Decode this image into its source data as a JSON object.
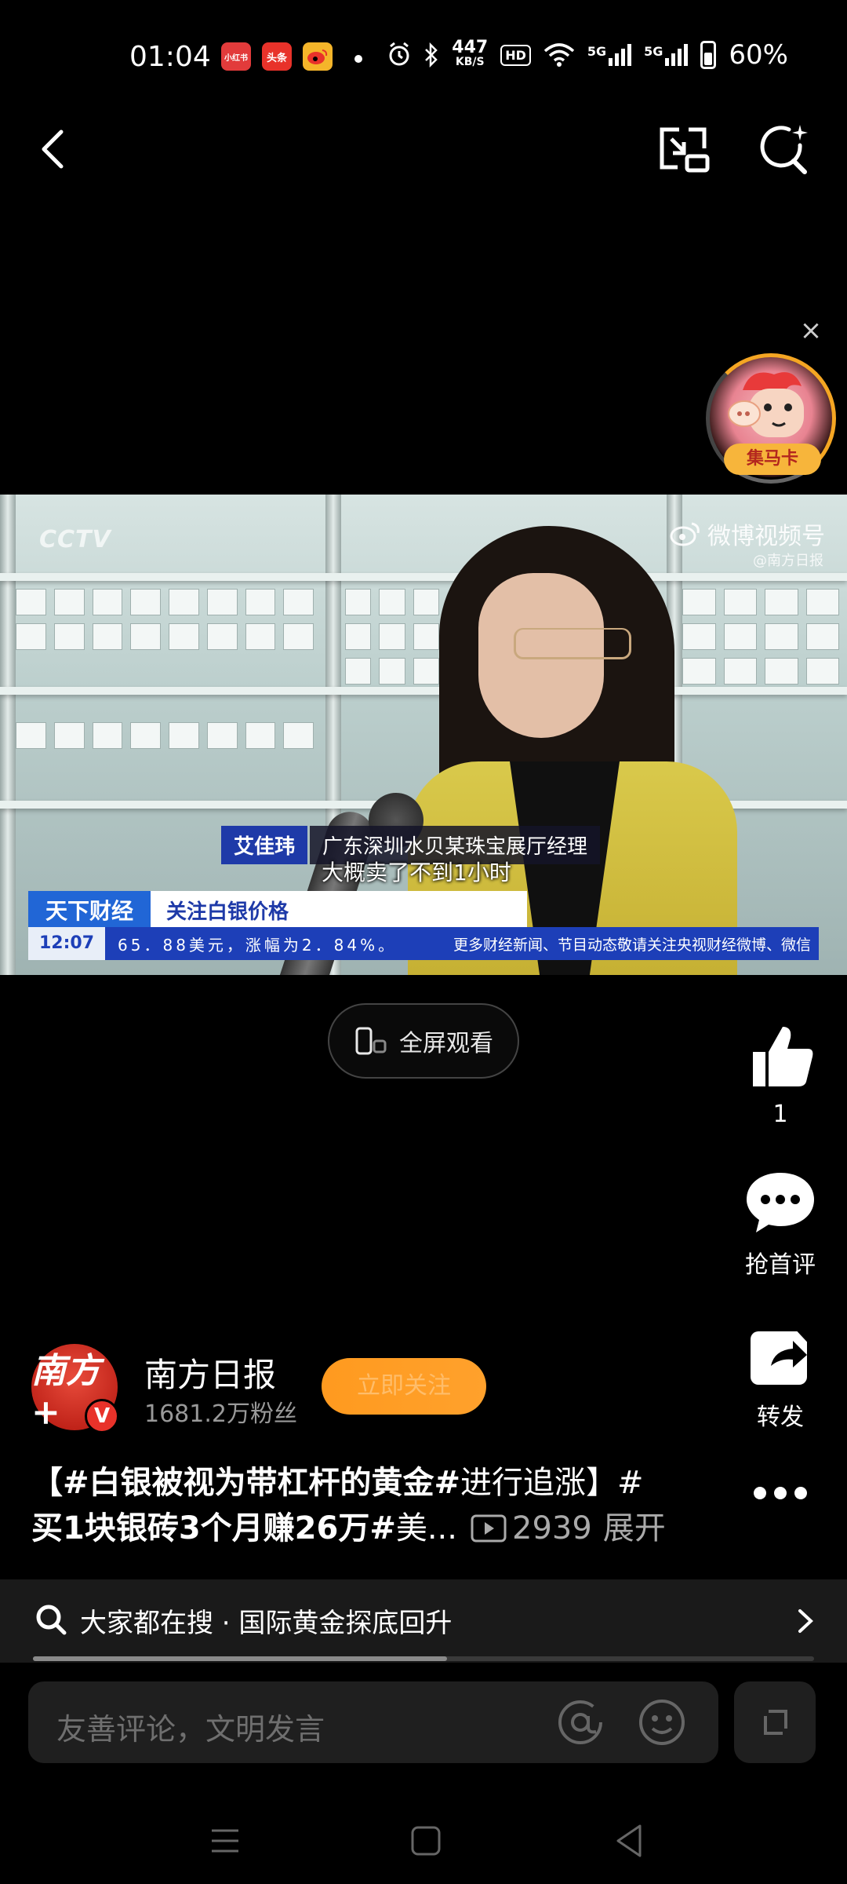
{
  "status_bar": {
    "time": "01:04",
    "app_icons": [
      {
        "label": "小红书",
        "color": "#e23b3b"
      },
      {
        "label": "头条",
        "color": "#e8322a"
      },
      {
        "label": "微博",
        "color": "#f5b52a"
      }
    ],
    "net_speed_value": "447",
    "net_speed_unit": "KB/S",
    "hd": "HD",
    "signal_1": "5G",
    "signal_2": "5G",
    "battery": "60%"
  },
  "nav": {
    "back": "back-arrow-icon",
    "pip": "picture-in-picture-icon",
    "smart_search": "sparkle-search-icon"
  },
  "float_card": {
    "close": "×",
    "label": "集马卡"
  },
  "video": {
    "channel_logo": "CCTV",
    "watermark": "微博视频号",
    "watermark_sub": "@南方日报",
    "speaker_name": "艾佳玮",
    "speaker_title": "广东深圳水贝某珠宝展厅经理",
    "subtitle": "大概卖了不到1小时",
    "program": "天下财经",
    "topic": "关注白银价格",
    "ticker_time": "12:07",
    "ticker_text": "65．88美元，涨幅为2．84%。",
    "ticker_text2": "更多财经新闻、节目动态敬请关注央视财经微博、微信"
  },
  "fullscreen_button": "全屏观看",
  "actions": {
    "like_count": "1",
    "comment_label": "抢首评",
    "share_label": "转发"
  },
  "author": {
    "avatar_text": "南方+",
    "verified": "V",
    "name": "南方日报",
    "fans": "1681.2万粉丝",
    "follow_label": "立即关注"
  },
  "caption": {
    "line1_bold": "【#白银被视为带杠杆的黄金#",
    "line1_normal": "进行追涨】#",
    "line2_bold": "买1块银砖3个月赚26万#",
    "line2_normal": " 美...",
    "views": "2939",
    "expand": "展开"
  },
  "search": {
    "text": "大家都在搜 · 国际黄金探底回升",
    "progress": 0.53
  },
  "comment": {
    "placeholder": "友善评论，文明发言"
  },
  "colors": {
    "accent_orange": "#ff9a1f",
    "cctv_blue": "#1d3fb8"
  }
}
